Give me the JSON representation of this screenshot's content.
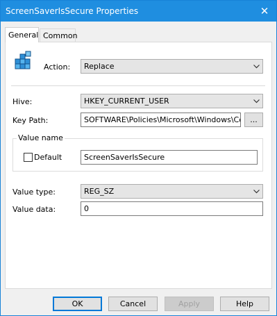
{
  "window": {
    "title": "ScreenSaverIsSecure Properties",
    "close_glyph": "✕"
  },
  "tabs": [
    {
      "label": "General",
      "active": true
    },
    {
      "label": "Common",
      "active": false
    }
  ],
  "icon": "registry-icon",
  "fields": {
    "action": {
      "label": "Action:",
      "value": "Replace"
    },
    "hive": {
      "label": "Hive:",
      "value": "HKEY_CURRENT_USER"
    },
    "key_path": {
      "label": "Key Path:",
      "value": "SOFTWARE\\Policies\\Microsoft\\Windows\\Control Panel\\Desktop",
      "browse_label": "..."
    },
    "value_name": {
      "group_label": "Value name",
      "default_label": "Default",
      "default_checked": false,
      "value": "ScreenSaverIsSecure"
    },
    "value_type": {
      "label": "Value type:",
      "value": "REG_SZ"
    },
    "value_data": {
      "label": "Value data:",
      "value": "0"
    }
  },
  "buttons": {
    "ok": "OK",
    "cancel": "Cancel",
    "apply": "Apply",
    "help": "Help"
  },
  "colors": {
    "titlebar": "#1f8ee0",
    "accent": "#0078d7"
  }
}
